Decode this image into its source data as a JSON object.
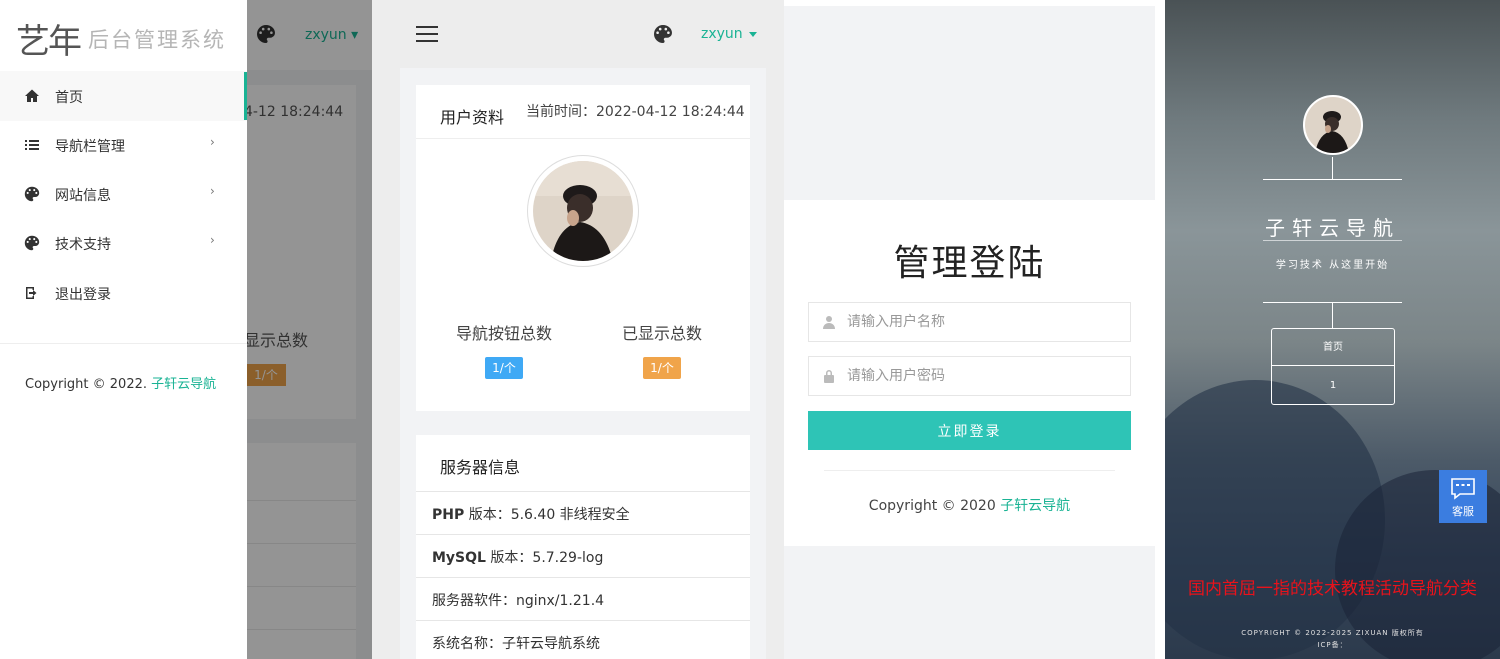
{
  "panel1": {
    "logo_mark": "艺年",
    "logo_text": "后台管理系统",
    "username": "zxyun",
    "menu": [
      {
        "label": "首页",
        "icon": "home-icon"
      },
      {
        "label": "导航栏管理",
        "icon": "list-icon"
      },
      {
        "label": "网站信息",
        "icon": "palette-icon"
      },
      {
        "label": "技术支持",
        "icon": "palette-icon"
      },
      {
        "label": "退出登录",
        "icon": "logout-icon"
      }
    ],
    "copyright_prefix": "Copyright © 2022.",
    "copyright_link": "子轩云导航",
    "bg_time": "4-12 18:24:44",
    "bg_label": "显示总数",
    "bg_badge": "1/个",
    "accent": "#1ab394"
  },
  "panel2": {
    "username": "zxyun",
    "profile_title": "用户资料",
    "current_time": "当前时间：2022-04-12 18:24:44",
    "stats": [
      {
        "label": "导航按钮总数",
        "value": "1/个",
        "color": "#3fa9f5"
      },
      {
        "label": "已显示总数",
        "value": "1/个",
        "color": "#f0a44a"
      }
    ],
    "server_title": "服务器信息",
    "server_info": [
      {
        "key": "PHP",
        "rest": " 版本：5.6.40 非线程安全"
      },
      {
        "key": "MySQL",
        "rest": " 版本：5.7.29-log"
      },
      {
        "key": "",
        "rest": "服务器软件：nginx/1.21.4"
      },
      {
        "key": "",
        "rest": "系统名称：子轩云导航系统"
      }
    ]
  },
  "panel3": {
    "title": "管理登陆",
    "username_placeholder": "请输入用户名称",
    "password_placeholder": "请输入用户密码",
    "login_button": "立即登录",
    "copyright_prefix": "Copyright © 2020",
    "copyright_link": "子轩云导航",
    "button_color": "#2ec4b6"
  },
  "panel4": {
    "site_title": "子轩云导航",
    "site_subtitle": "学习技术 从这里开始",
    "nav_items": [
      "首页",
      "1"
    ],
    "kefu_label": "客服",
    "promo_text": "国内首屈一指的技术教程活动导航分类",
    "footer_line1": "COPYRIGHT © 2022-2025 ZIXUAN 版权所有",
    "footer_line2": "ICP备：",
    "promo_color": "#e8121b"
  }
}
